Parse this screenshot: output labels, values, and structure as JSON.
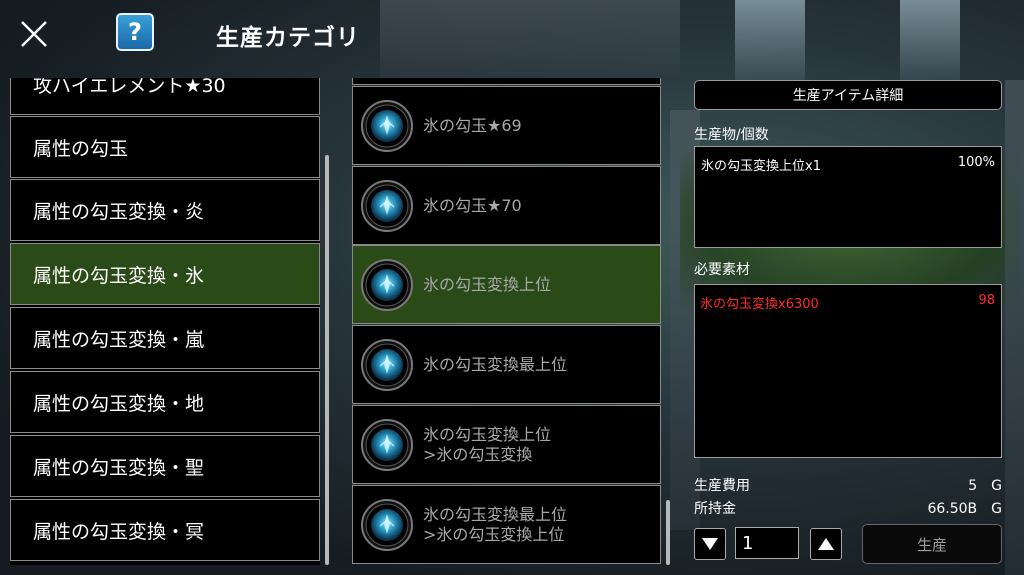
{
  "header": {
    "title": "生産カテゴリ",
    "help_label": "?"
  },
  "categories": [
    {
      "label": "攻ハイエレメント★30"
    },
    {
      "label": "属性の勾玉"
    },
    {
      "label": "属性の勾玉変換・炎"
    },
    {
      "label": "属性の勾玉変換・氷",
      "selected": true
    },
    {
      "label": "属性の勾玉変換・嵐"
    },
    {
      "label": "属性の勾玉変換・地"
    },
    {
      "label": "属性の勾玉変換・聖"
    },
    {
      "label": "属性の勾玉変換・冥"
    }
  ],
  "items": [
    {
      "line1": "氷の勾玉★69",
      "line2": "",
      "icon": "ice-orb-icon"
    },
    {
      "line1": "氷の勾玉★70",
      "line2": "",
      "icon": "ice-orb-icon"
    },
    {
      "line1": "氷の勾玉変換上位",
      "line2": "",
      "icon": "ice-orb-icon",
      "selected": true
    },
    {
      "line1": "氷の勾玉変換最上位",
      "line2": "",
      "icon": "ice-orb-icon"
    },
    {
      "line1": "氷の勾玉変換上位",
      "line2": ">氷の勾玉変換",
      "icon": "ice-orb-icon"
    },
    {
      "line1": "氷の勾玉変換最上位",
      "line2": ">氷の勾玉変換上位",
      "icon": "ice-orb-icon"
    }
  ],
  "detail": {
    "header": "生産アイテム詳細",
    "product_label": "生産物/個数",
    "product_name": "氷の勾玉変換上位x1",
    "product_rate": "100%",
    "materials_label": "必要素材",
    "material_name": "氷の勾玉変換x6300",
    "material_owned": "98",
    "cost_label": "生産費用",
    "cost_value": "5　G",
    "money_label": "所持金",
    "money_value": "66.50B　G",
    "quantity": "1",
    "produce_label": "生産"
  },
  "colors": {
    "selected_bg": "#2a4a18",
    "material_insufficient": "#ff2a2a",
    "help_button": "#2a86c8"
  }
}
